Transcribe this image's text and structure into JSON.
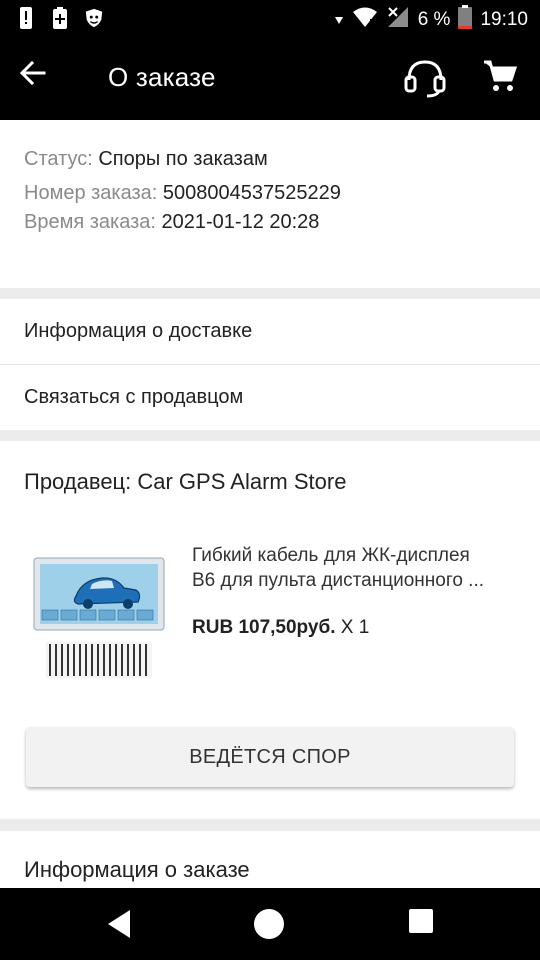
{
  "status_bar": {
    "battery_percent": "6 %",
    "time": "19:10",
    "icons": [
      "alert-icon",
      "battery-plus-icon",
      "shield-app-icon",
      "signal-dot-icon",
      "wifi-icon",
      "cellular-no-signal-icon",
      "battery-low-icon"
    ]
  },
  "app_bar": {
    "title": "О заказе",
    "icons": [
      "back-arrow-icon",
      "headset-icon",
      "cart-icon"
    ]
  },
  "order": {
    "status_label": "Статус:",
    "status_value": "Споры по заказам",
    "number_label": "Номер заказа:",
    "number_value": "5008004537525229",
    "time_label": "Время заказа:",
    "time_value": "2021-01-12 20:28"
  },
  "links": {
    "delivery": "Информация о доставке",
    "contact": "Связаться с продавцом"
  },
  "product": {
    "seller": "Продавец: Car GPS Alarm Store",
    "name_line1": "Гибкий кабель для ЖК-дисплея",
    "name_line2": "B6 для пульта дистанционного ...",
    "price": "RUB 107,50руб.",
    "quantity": "X 1",
    "action_button": "ВЕДЁТСЯ СПОР"
  },
  "order_info_title": "Информация о заказе",
  "nav_bar": {
    "icons": [
      "nav-back-icon",
      "nav-home-icon",
      "nav-recents-icon"
    ]
  },
  "colors": {
    "bars": "#000000",
    "background": "#ececec",
    "card": "#ffffff",
    "label_gray": "#8a8a8a",
    "battery_low": "#e53935"
  }
}
